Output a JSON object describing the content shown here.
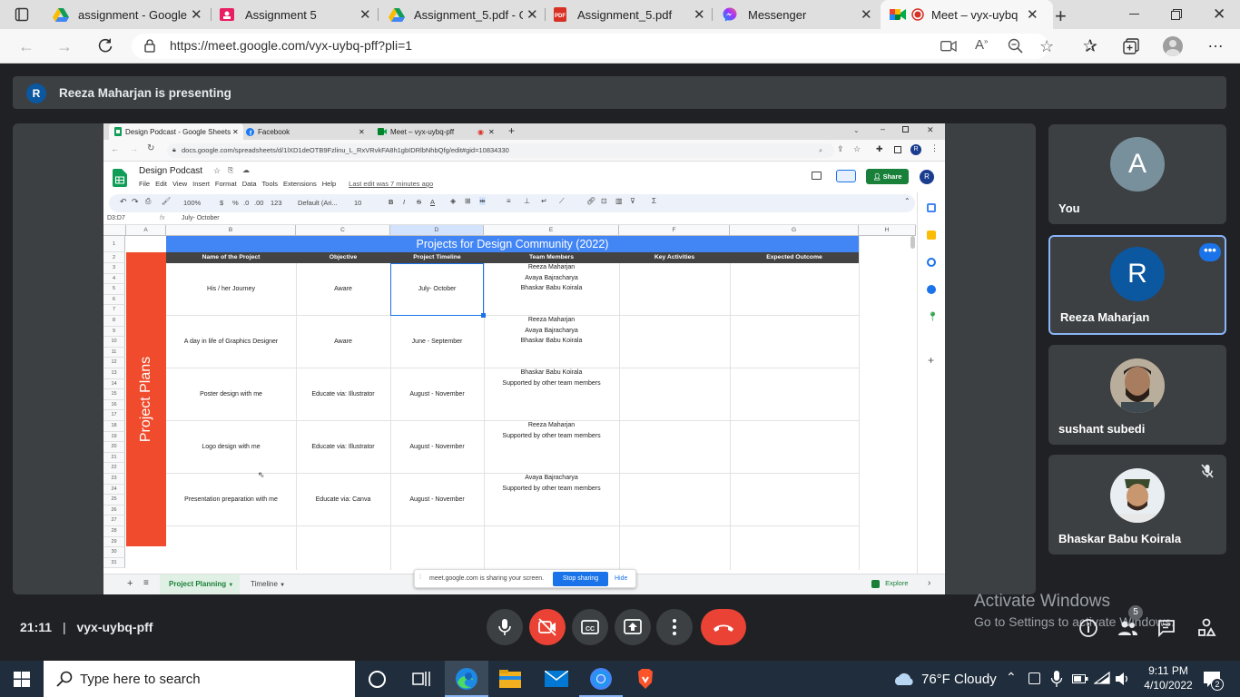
{
  "browser": {
    "tabs": [
      {
        "title": "assignment - Google D",
        "icon": "google-drive-icon"
      },
      {
        "title": "Assignment 5",
        "icon": "google-classroom-icon"
      },
      {
        "title": "Assignment_5.pdf - Go",
        "icon": "google-drive-icon"
      },
      {
        "title": "Assignment_5.pdf",
        "icon": "pdf-icon"
      },
      {
        "title": "Messenger",
        "icon": "messenger-icon"
      },
      {
        "title": "Meet – vyx-uybq",
        "icon": "google-meet-icon"
      }
    ],
    "active_tab": 5,
    "url": "https://meet.google.com/vyx-uybq-pff?pli=1"
  },
  "meet": {
    "presenter_initial": "R",
    "presenter_text": "Reeza Maharjan is presenting",
    "time": "21:11",
    "separator": "|",
    "meeting_code": "vyx-uybq-pff",
    "participants_count": "5",
    "tiles": [
      {
        "name": "You",
        "initial": "A",
        "color": "#78909c"
      },
      {
        "name": "Reeza Maharjan",
        "initial": "R",
        "color": "#0b57a0"
      },
      {
        "name": "sushant subedi",
        "photo": true
      },
      {
        "name": "Bhaskar Babu Koirala",
        "photo": true,
        "muted": true
      }
    ],
    "activate": {
      "title": "Activate Windows",
      "subtitle": "Go to Settings to activate Windows."
    }
  },
  "shared_screen": {
    "tabs": [
      {
        "title": "Design Podcast - Google Sheets"
      },
      {
        "title": "Facebook"
      },
      {
        "title": "Meet – vyx-uybq-pff"
      }
    ],
    "url": "docs.google.com/spreadsheets/d/1lXD1deOTB9Fzlinu_L_RxVRvkFA8h1gbIDRlbNhbQfg/edit#gid=10834330",
    "doc_title": "Design Podcast",
    "menu": [
      "File",
      "Edit",
      "View",
      "Insert",
      "Format",
      "Data",
      "Tools",
      "Extensions",
      "Help"
    ],
    "last_edit": "Last edit was 7 minutes ago",
    "share_label": "Share",
    "user_initial": "R",
    "toolbar": {
      "zoom": "100%",
      "currency": "$",
      "percent": "%",
      "dec0": ".0",
      "dec00": ".00",
      "num": "123",
      "font": "Default (Ari...",
      "size": "10",
      "bold": "B",
      "italic": "I",
      "strike": "S",
      "text_color": "A"
    },
    "cell_ref": "D3:D7",
    "fx": "fx",
    "formula": "July- October",
    "columns": [
      "A",
      "B",
      "C",
      "D",
      "E",
      "F",
      "G",
      "H"
    ],
    "rows": [
      "1",
      "2",
      "3",
      "4",
      "5",
      "6",
      "7",
      "8",
      "9",
      "10",
      "11",
      "12",
      "13",
      "14",
      "15",
      "16",
      "17",
      "18",
      "19",
      "20",
      "21",
      "22",
      "23",
      "24",
      "25",
      "26",
      "27",
      "28",
      "29",
      "30",
      "31"
    ],
    "sheet_title": "Projects for Design Community (2022)",
    "headers": [
      "Name of the Project",
      "Objective",
      "Project Timeline",
      "Team Members",
      "Key Activities",
      "Expected Outcome"
    ],
    "side_label": "Project Plans",
    "projects": [
      {
        "name": "His / her Journey",
        "objective": "Aware",
        "timeline": "July- October",
        "members": [
          "Reeza Maharjan",
          "Avaya Bajracharya",
          "Bhaskar Babu Koirala"
        ]
      },
      {
        "name": "A day in life of Graphics Designer",
        "objective": "Aware",
        "timeline": "June - September",
        "members": [
          "Reeza Maharjan",
          "Avaya Bajracharya",
          "Bhaskar Babu Koirala"
        ]
      },
      {
        "name": "Poster design with me",
        "objective": "Educate via: Illustrator",
        "timeline": "August - November",
        "members": [
          "Bhaskar Babu Koirala",
          "Supported by other team members"
        ]
      },
      {
        "name": "Logo design with me",
        "objective": "Educate via: Illustrator",
        "timeline": "August - November",
        "members": [
          "Reeza Maharjan",
          "Supported by other team members"
        ]
      },
      {
        "name": "Presentation preparation with me",
        "objective": "Educate via: Canva",
        "timeline": "August - November",
        "members": [
          "Avaya Bajracharya",
          "Supported by other team members"
        ]
      }
    ],
    "sheet_tabs": [
      "Project Planning",
      "Timeline"
    ],
    "sharing_note": "meet.google.com is sharing your screen.",
    "stop_sharing": "Stop sharing",
    "hide": "Hide",
    "explore": "Explore"
  },
  "taskbar": {
    "search_placeholder": "Type here to search",
    "weather": "76°F  Cloudy",
    "time": "9:11 PM",
    "date": "4/10/2022",
    "notifications": "2"
  }
}
